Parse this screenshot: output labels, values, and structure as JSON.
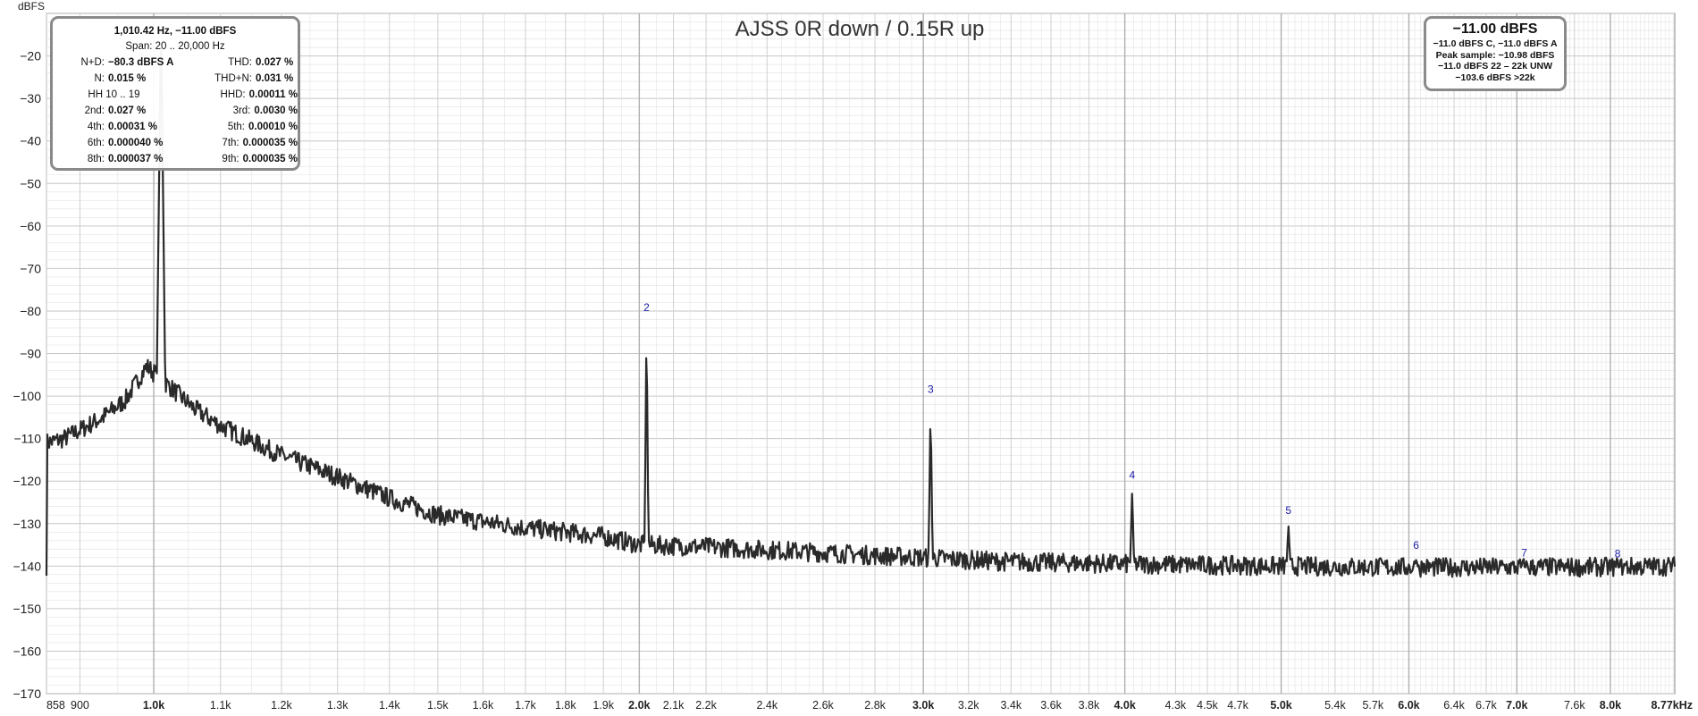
{
  "chart_data": {
    "type": "line",
    "title": "AJSS 0R down / 0.15R up",
    "ylabel": "dBFS",
    "xlabel": "",
    "x_scale": "log",
    "xlim": [
      858,
      8770
    ],
    "ylim": [
      -170,
      -10
    ],
    "grid": true,
    "y_ticks": [
      -20,
      -30,
      -40,
      -50,
      -60,
      -70,
      -80,
      -90,
      -100,
      -110,
      -120,
      -130,
      -140,
      -150,
      -160,
      -170
    ],
    "x_ticks": [
      {
        "v": 858,
        "label": "858",
        "major": false
      },
      {
        "v": 900,
        "label": "900",
        "major": false
      },
      {
        "v": 1000,
        "label": "1.0k",
        "major": true
      },
      {
        "v": 1100,
        "label": "1.1k",
        "major": false
      },
      {
        "v": 1200,
        "label": "1.2k",
        "major": false
      },
      {
        "v": 1300,
        "label": "1.3k",
        "major": false
      },
      {
        "v": 1400,
        "label": "1.4k",
        "major": false
      },
      {
        "v": 1500,
        "label": "1.5k",
        "major": false
      },
      {
        "v": 1600,
        "label": "1.6k",
        "major": false
      },
      {
        "v": 1700,
        "label": "1.7k",
        "major": false
      },
      {
        "v": 1800,
        "label": "1.8k",
        "major": false
      },
      {
        "v": 1900,
        "label": "1.9k",
        "major": false
      },
      {
        "v": 2000,
        "label": "2.0k",
        "major": true
      },
      {
        "v": 2100,
        "label": "2.1k",
        "major": false
      },
      {
        "v": 2200,
        "label": "2.2k",
        "major": false
      },
      {
        "v": 2400,
        "label": "2.4k",
        "major": false
      },
      {
        "v": 2600,
        "label": "2.6k",
        "major": false
      },
      {
        "v": 2800,
        "label": "2.8k",
        "major": false
      },
      {
        "v": 3000,
        "label": "3.0k",
        "major": true
      },
      {
        "v": 3200,
        "label": "3.2k",
        "major": false
      },
      {
        "v": 3400,
        "label": "3.4k",
        "major": false
      },
      {
        "v": 3600,
        "label": "3.6k",
        "major": false
      },
      {
        "v": 3800,
        "label": "3.8k",
        "major": false
      },
      {
        "v": 4000,
        "label": "4.0k",
        "major": true
      },
      {
        "v": 4300,
        "label": "4.3k",
        "major": false
      },
      {
        "v": 4500,
        "label": "4.5k",
        "major": false
      },
      {
        "v": 4700,
        "label": "4.7k",
        "major": false
      },
      {
        "v": 5000,
        "label": "5.0k",
        "major": true
      },
      {
        "v": 5400,
        "label": "5.4k",
        "major": false
      },
      {
        "v": 5700,
        "label": "5.7k",
        "major": false
      },
      {
        "v": 6000,
        "label": "6.0k",
        "major": true
      },
      {
        "v": 6400,
        "label": "6.4k",
        "major": false
      },
      {
        "v": 6700,
        "label": "6.7k",
        "major": false
      },
      {
        "v": 7000,
        "label": "7.0k",
        "major": true
      },
      {
        "v": 7600,
        "label": "7.6k",
        "major": false
      },
      {
        "v": 8000,
        "label": "8.0k",
        "major": true
      },
      {
        "v": 8770,
        "label": "8.77kHz",
        "major": true
      }
    ],
    "fundamental": {
      "freq_hz": 1010.42,
      "level_dbfs": -11.0
    },
    "harmonics": [
      {
        "n": 2,
        "label": "2",
        "freq_hz": 2020.8,
        "level_dbfs": -82.5
      },
      {
        "n": 3,
        "label": "3",
        "freq_hz": 3031.3,
        "level_dbfs": -101.8
      },
      {
        "n": 4,
        "label": "4",
        "freq_hz": 4041.7,
        "level_dbfs": -122.0
      },
      {
        "n": 5,
        "label": "5",
        "freq_hz": 5052.1,
        "level_dbfs": -130.3
      },
      {
        "n": 6,
        "label": "6",
        "freq_hz": 6062.5,
        "level_dbfs": -138.5
      },
      {
        "n": 7,
        "label": "7",
        "freq_hz": 7072.9,
        "level_dbfs": -140.2
      },
      {
        "n": 8,
        "label": "8",
        "freq_hz": 8083.4,
        "level_dbfs": -140.5
      }
    ],
    "noise_floor": [
      [
        858,
        -111
      ],
      [
        880,
        -110
      ],
      [
        900,
        -108
      ],
      [
        930,
        -105
      ],
      [
        960,
        -101
      ],
      [
        990,
        -93
      ],
      [
        1060,
        -103
      ],
      [
        1100,
        -107
      ],
      [
        1200,
        -114
      ],
      [
        1300,
        -119
      ],
      [
        1400,
        -124
      ],
      [
        1500,
        -128
      ],
      [
        1700,
        -131
      ],
      [
        1900,
        -133
      ],
      [
        2000,
        -135
      ],
      [
        2200,
        -135.5
      ],
      [
        2500,
        -136.5
      ],
      [
        2800,
        -137.5
      ],
      [
        3000,
        -138
      ],
      [
        3400,
        -139
      ],
      [
        4000,
        -139.5
      ],
      [
        5000,
        -140
      ],
      [
        6000,
        -140.3
      ],
      [
        7000,
        -140.3
      ],
      [
        8000,
        -140.2
      ],
      [
        8770,
        -140
      ]
    ]
  },
  "stats_panel": {
    "header": "1,010.42 Hz, −11.00 dBFS",
    "span": "Span: 20 .. 20,000 Hz",
    "rows": [
      {
        "l1": "N+D:",
        "v1": "−80.3 dBFS A",
        "l2": "THD:",
        "v2": "0.027 %"
      },
      {
        "l1": "N:",
        "v1": "0.015 %",
        "l2": "THD+N:",
        "v2": "0.031 %"
      },
      {
        "l1": "",
        "v1": "",
        "l2": "HHD:",
        "v2": "0.00011 %"
      },
      {
        "l1": "2nd:",
        "v1": "0.027 %",
        "l2": "3rd:",
        "v2": "0.0030 %"
      },
      {
        "l1": "4th:",
        "v1": "0.00031 %",
        "l2": "5th:",
        "v2": "0.00010 %"
      },
      {
        "l1": "6th:",
        "v1": "0.000040 %",
        "l2": "7th:",
        "v2": "0.000035 %"
      },
      {
        "l1": "8th:",
        "v1": "0.000037 %",
        "l2": "9th:",
        "v2": "0.000035 %"
      }
    ],
    "hh_range": "HH 10 .. 19"
  },
  "level_panel": {
    "main": "−11.00 dBFS",
    "lines": [
      "−11.0 dBFS C, −11.0 dBFS A",
      "Peak sample: −10.98 dBFS",
      "−11.0 dBFS 22 – 22k UNW",
      "−103.6 dBFS >22k"
    ]
  },
  "colors": {
    "trace": "#2a2a2a",
    "grid": "#e2e2e2",
    "grid_major": "#c6c6c6",
    "harmonic_label": "#1a1aa6"
  }
}
